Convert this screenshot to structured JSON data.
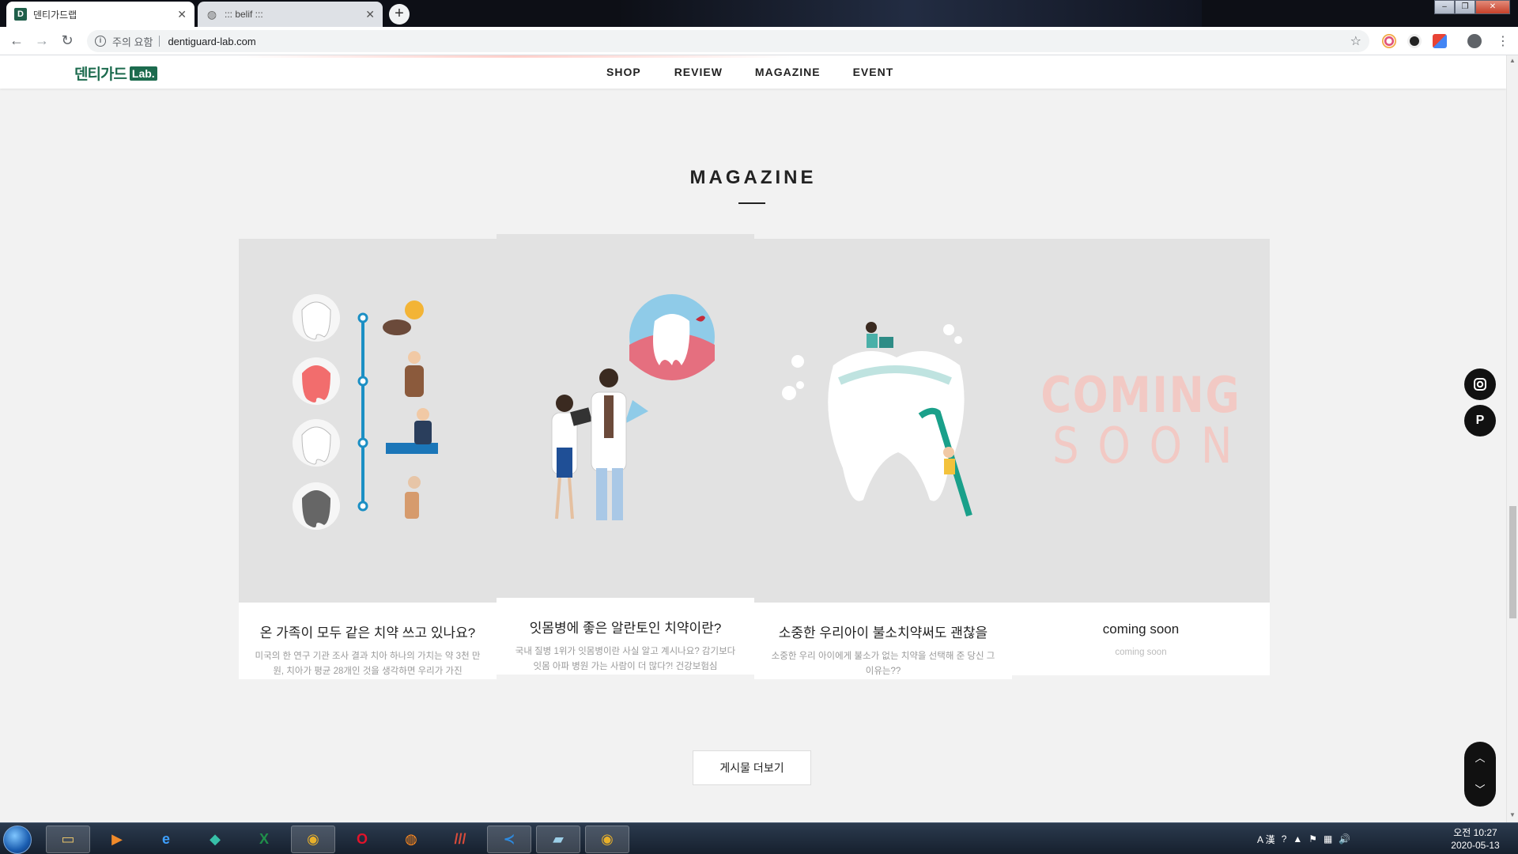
{
  "browser": {
    "tabs": [
      {
        "title": "덴티가드랩",
        "favicon": "D"
      },
      {
        "title": "::: belif :::"
      }
    ],
    "security_label": "주의 요함",
    "url": "dentiguard-lab.com"
  },
  "site": {
    "logo_text": "덴티가드",
    "logo_badge": "Lab.",
    "nav": [
      "SHOP",
      "REVIEW",
      "MAGAZINE",
      "EVENT"
    ]
  },
  "section": {
    "title": "MAGAZINE",
    "cards": [
      {
        "title": "온 가족이 모두 같은 치약 쓰고 있나요?",
        "desc": "미국의 한 연구 기관 조사 결과 치아 하나의 가치는 약 3천 만원, 치아가 평균 28개인 것을 생각하면 우리가 가진"
      },
      {
        "title": "잇몸병에 좋은 알란토인 치약이란?",
        "desc": "국내 질병 1위가 잇몸병이란 사실 알고 계시나요? 감기보다 잇몸 아파 병원 가는 사람이 더 많다?! 건강보험심"
      },
      {
        "title": "소중한 우리아이 불소치약써도 괜찮을",
        "desc": "소중한 우리 아이에게 불소가 없는 치약을 선택해 준 당신 그이유는??"
      },
      {
        "title": "coming soon",
        "desc": "coming soon",
        "thumb_line1": "COMING",
        "thumb_line2": "SOON"
      }
    ],
    "more_button": "게시물 더보기"
  },
  "floating": {
    "social1": "instagram-icon",
    "social2": "P"
  },
  "taskbar": {
    "ime": "A 漢",
    "time": "오전 10:27",
    "date": "2020-05-13"
  },
  "colors": {
    "brand_green": "#1c6b4e",
    "coming_soon_pink": "#f2c9c4",
    "page_bg": "#f2f2f2"
  }
}
